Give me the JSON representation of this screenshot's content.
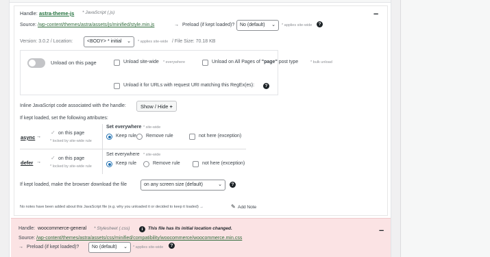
{
  "card1": {
    "handle_label": "Handle:",
    "handle_name": "astra-theme-js",
    "handle_type": "* JavaScript (.js)",
    "source_label": "Source:",
    "source_path": "/wp-content/themes/astra/assets/js/minified/style.min.js",
    "source_arrow": "→",
    "preload_label": "Preload (if kept loaded)?",
    "preload_value": "No (default)",
    "preload_note": "* applies site-wide",
    "version_line": "Version: 3.0.2  /  Location:",
    "location_value": "<BODY> * initial",
    "location_note": "* applies site-wide",
    "filesize": "/  File Size: 70.18 KB",
    "unload_page_label": "Unload on this page",
    "unload_site_label": "Unload site-wide",
    "unload_site_note": "* everywhere",
    "unload_all_pages_pre": "Unload on All Pages of",
    "unload_all_pages_bold": "\"page\"",
    "unload_all_pages_post": "post type",
    "unload_all_pages_note": "* bulk unload",
    "unload_regex_label": "Unload it for URLs with request URI matching this RegEx(es):",
    "inline_label": "Inline JavaScript code associated with the handle:",
    "show_hide_label": "Show / Hide",
    "show_hide_icon": "+",
    "attrs_intro": "If kept loaded, set the following attributes:",
    "attributes": [
      {
        "name": "async",
        "arrow": "→",
        "check": "✓",
        "on_page": "on this page",
        "locked": "* locked by site-wide rule",
        "set_everywhere": "Set everywhere",
        "site_wide": "* site-wide",
        "keep": "Keep rule",
        "remove": "Remove rule",
        "not_here": "not here (exception)"
      },
      {
        "name": "defer",
        "arrow": "→",
        "check": "✓",
        "on_page": "on this page",
        "locked": "* locked by site-wide rule",
        "set_everywhere": "Set everywhere",
        "site_wide": "* site-wide",
        "keep": "Keep rule",
        "remove": "Remove rule",
        "not_here": "not here (exception)"
      }
    ],
    "download_label": "If kept loaded, make the browser download the file",
    "download_value": "on any screen size (default)",
    "notes_text": "No notes have been added about this JavaScript file (e.g. why you unloaded it or decided to keep it loaded) →",
    "add_note": "Add Note",
    "pencil_icon": "✎",
    "collapse_icon": "–"
  },
  "card2": {
    "handle_label": "Handle:",
    "handle_name": "woocommerce-general",
    "handle_type": "* Stylesheet (.css)",
    "location_changed": "This file has its initial location changed.",
    "info_icon": "i",
    "source_label": "Source:",
    "source_path": "/wp-content/themes/astra/assets/css/minified/compatibility/woocommerce/woocommerce.min.css",
    "preload_arrow": "→",
    "preload_label": "Preload (if kept loaded)?",
    "preload_value": "No (default)",
    "preload_note": "* applies site-wide",
    "collapse_icon": "–"
  },
  "icons": {
    "help": "?",
    "chevron": "⌄"
  }
}
